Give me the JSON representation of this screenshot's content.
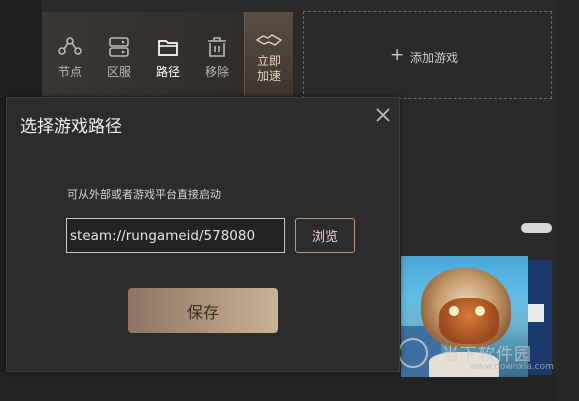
{
  "toolbar": {
    "items": [
      {
        "icon": "nodes-icon",
        "label": "节点"
      },
      {
        "icon": "server-icon",
        "label": "区服"
      },
      {
        "icon": "folder-icon",
        "label": "路径"
      },
      {
        "icon": "trash-icon",
        "label": "移除"
      }
    ],
    "boost_label": "立即加速",
    "boost_line1": "立即",
    "boost_line2": "加速"
  },
  "add_game": {
    "icon": "plus-icon",
    "label": "添加游戏"
  },
  "dialog": {
    "title": "选择游戏路径",
    "hint": "可从外部或者游戏平台直接启动",
    "path_value": "steam://rungameid/578080",
    "browse_label": "浏览",
    "save_label": "保存",
    "close_icon": "close-icon"
  },
  "watermark": {
    "text": "当下软件园",
    "url": "www.downxia.com"
  },
  "colors": {
    "background": "#2a2a2a",
    "dialog_bg": "#2c2c2c",
    "accent": "#b59a7f",
    "save_button": "#b2967c"
  }
}
